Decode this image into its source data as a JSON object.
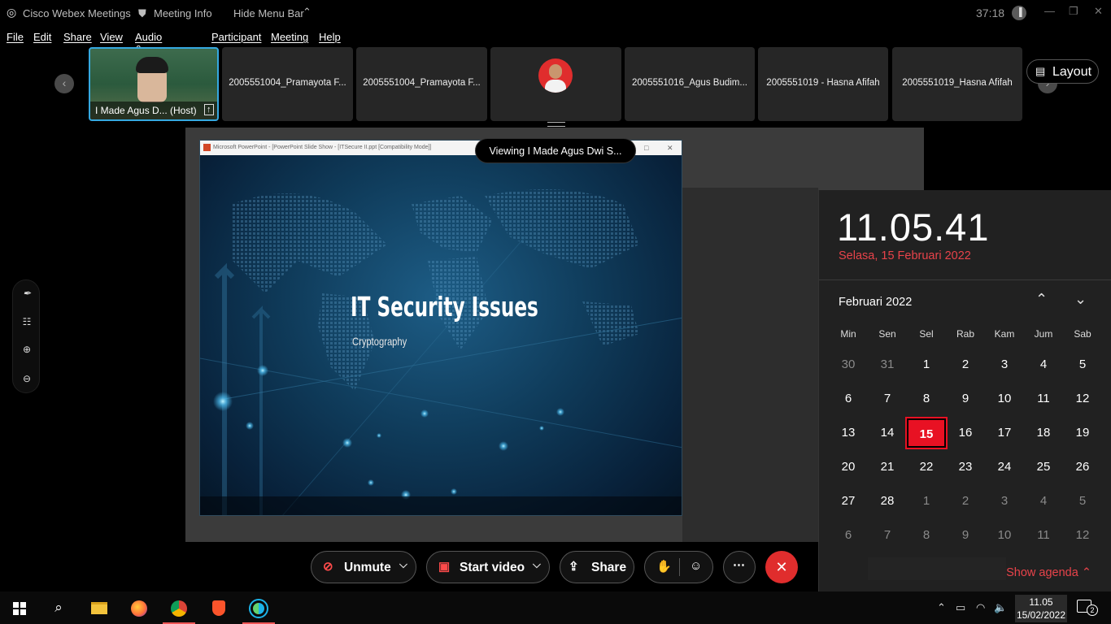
{
  "title_bar": {
    "app_name": "Cisco Webex Meetings",
    "meeting_info": "Meeting Info",
    "hide_menu_bar": "Hide Menu Bar",
    "timer": "37:18"
  },
  "menu": [
    "File",
    "Edit",
    "Share",
    "View",
    "Audio & Video",
    "Participant",
    "Meeting",
    "Help"
  ],
  "participants": [
    {
      "name": "I Made Agus D...",
      "role": "(Host)"
    },
    {
      "name": "2005551004_Pramayota F..."
    },
    {
      "name": "2005551004_Pramayota F..."
    },
    {
      "name": ""
    },
    {
      "name": "2005551016_Agus Budim..."
    },
    {
      "name": "2005551019 - Hasna Afifah"
    },
    {
      "name": "2005551019_Hasna Afifah"
    }
  ],
  "layout_button": "Layout",
  "share": {
    "viewing_label": "Viewing I Made Agus Dwi S...",
    "ppt_window_title": "Microsoft PowerPoint - [PowerPoint Slide Show - [ITSecure II.ppt [Compatibility Mode]]",
    "slide_title": "IT Security Issues",
    "slide_subtitle": "Cryptography"
  },
  "controls": {
    "unmute": "Unmute",
    "start_video": "Start video",
    "share": "Share"
  },
  "calendar": {
    "clock": "11.05.41",
    "date_long": "Selasa, 15 Februari 2022",
    "month": "Februari 2022",
    "weekdays": [
      "Min",
      "Sen",
      "Sel",
      "Rab",
      "Kam",
      "Jum",
      "Sab"
    ],
    "days": [
      [
        "30",
        "31",
        "1",
        "2",
        "3",
        "4",
        "5"
      ],
      [
        "6",
        "7",
        "8",
        "9",
        "10",
        "11",
        "12"
      ],
      [
        "13",
        "14",
        "15",
        "16",
        "17",
        "18",
        "19"
      ],
      [
        "20",
        "21",
        "22",
        "23",
        "24",
        "25",
        "26"
      ],
      [
        "27",
        "28",
        "1",
        "2",
        "3",
        "4",
        "5"
      ],
      [
        "6",
        "7",
        "8",
        "9",
        "10",
        "11",
        "12"
      ]
    ],
    "today": "15",
    "show_agenda": "Show agenda"
  },
  "taskbar": {
    "time": "11.05",
    "date": "15/02/2022",
    "notifications": "2"
  },
  "colors": {
    "accent_red": "#e81123",
    "webex_red": "#e02d2d",
    "calendar_text_red": "#e8434a"
  }
}
